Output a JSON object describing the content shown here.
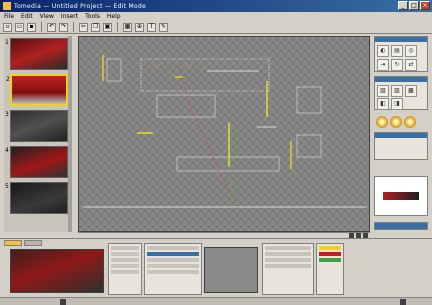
{
  "window": {
    "title": "Tomedia — Untitled Project — Edit Mode"
  },
  "menu": [
    "File",
    "Edit",
    "View",
    "Insert",
    "Tools",
    "Help"
  ],
  "toolbar": {
    "icons": [
      "new-icon",
      "open-icon",
      "save-icon",
      "undo-icon",
      "redo-icon",
      "cut-icon",
      "copy-icon",
      "paste-icon",
      "grid-icon",
      "zoom-icon",
      "text-icon",
      "draw-icon"
    ]
  },
  "thumbnails": [
    {
      "number": "1",
      "variant": "red-scene"
    },
    {
      "number": "2",
      "variant": "red-banner",
      "selected": true
    },
    {
      "number": "3",
      "variant": "dark-scene"
    },
    {
      "number": "4",
      "variant": "red-dark-scene"
    },
    {
      "number": "5",
      "variant": "dark-plain"
    }
  ],
  "colors": {
    "accent": "#f0d020",
    "title_bar": "#0a246a",
    "canvas": "#8a8a8a"
  }
}
